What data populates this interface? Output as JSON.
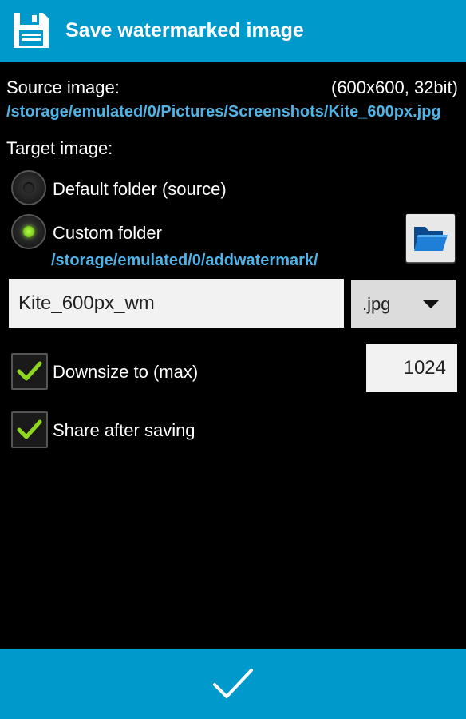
{
  "header": {
    "title": "Save watermarked image",
    "icon": "floppy-disk-icon"
  },
  "source": {
    "label": "Source image:",
    "info": "(600x600, 32bit)",
    "path": "/storage/emulated/0/Pictures/Screenshots/Kite_600px.jpg"
  },
  "target": {
    "label": "Target image:",
    "options": [
      {
        "label": "Default folder (source)",
        "selected": false
      },
      {
        "label": "Custom folder",
        "selected": true
      }
    ],
    "custom_path": "/storage/emulated/0/addwatermark/",
    "folder_button_icon": "folder-icon"
  },
  "file": {
    "name": "Kite_600px_wm",
    "extension": ".jpg"
  },
  "downsize": {
    "label": "Downsize to (max)",
    "checked": true,
    "value": "1024"
  },
  "share": {
    "label": "Share after saving",
    "checked": true
  },
  "footer": {
    "confirm_icon": "checkmark-icon"
  },
  "colors": {
    "accent": "#0099cc",
    "path_text": "#4fb3e6",
    "radio_selected": "#7ccf1a",
    "check": "#8fd61e"
  }
}
